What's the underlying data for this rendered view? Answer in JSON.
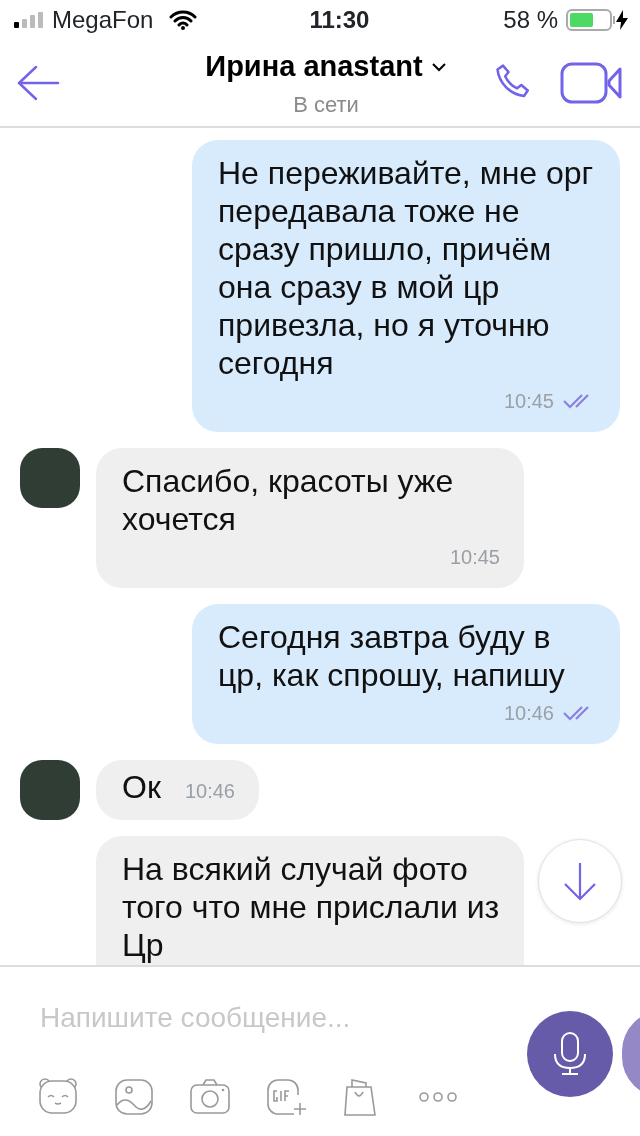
{
  "status_bar": {
    "carrier": "MegaFon",
    "time": "11:30",
    "battery": "58 %",
    "charging": true
  },
  "header": {
    "title": "Ирина anastant",
    "subtitle": "В сети"
  },
  "messages": [
    {
      "kind": "outgoing",
      "text": "Не переживайте, мне орг передавала тоже не сразу пришло, причём она сразу в мой цр привезла, но я уточню сегодня",
      "time": "10:45",
      "read": true
    },
    {
      "kind": "incoming",
      "avatar": true,
      "text": "Спасибо, красоты уже хочется",
      "time": "10:45"
    },
    {
      "kind": "outgoing",
      "text": "Сегодня завтра буду в цр, как спрошу, напишу",
      "time": "10:46",
      "read": true
    },
    {
      "kind": "incoming",
      "avatar": true,
      "text": "Ок",
      "time": "10:46",
      "inline_time": true
    },
    {
      "kind": "incoming",
      "avatar": false,
      "text": "На всякий случай фото того что мне прислали из Цр"
    }
  ],
  "composer": {
    "placeholder": "Напишите сообщение..."
  }
}
